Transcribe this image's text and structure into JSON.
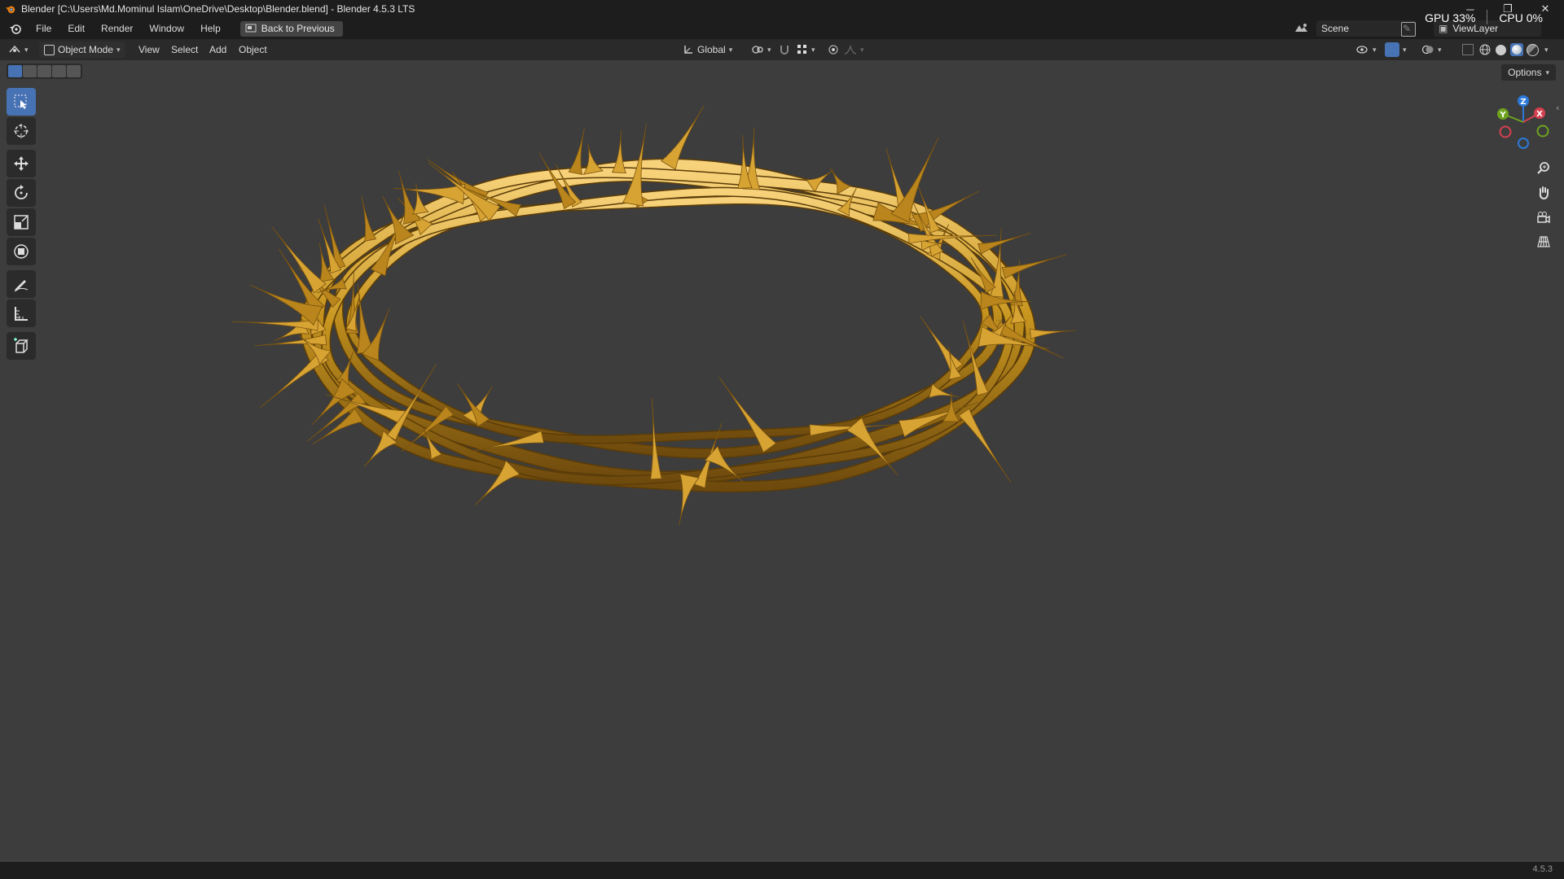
{
  "window": {
    "title": "Blender [C:\\Users\\Md.Mominul Islam\\OneDrive\\Desktop\\Blender.blend] - Blender 4.5.3 LTS",
    "minimize": "─",
    "maximize": "❐",
    "close": "✕"
  },
  "monitor": {
    "gpu": "GPU 33%",
    "cpu": "CPU 0%"
  },
  "menu": {
    "items": [
      "File",
      "Edit",
      "Render",
      "Window",
      "Help"
    ],
    "back_button": "Back to Previous"
  },
  "top_right": {
    "scene": "Scene",
    "view_layer": "ViewLayer"
  },
  "viewport_header": {
    "mode": "Object Mode",
    "menus": [
      "View",
      "Select",
      "Add",
      "Object"
    ],
    "transform_orientation": "Global"
  },
  "viewport": {
    "options_label": "Options",
    "gizmo_axes": {
      "x": "X",
      "y": "Y",
      "z": "Z"
    },
    "object_color": "#c8961f"
  },
  "status": {
    "version": "4.5.3"
  },
  "colors": {
    "accent": "#4772b3",
    "background": "#3d3d3d"
  }
}
